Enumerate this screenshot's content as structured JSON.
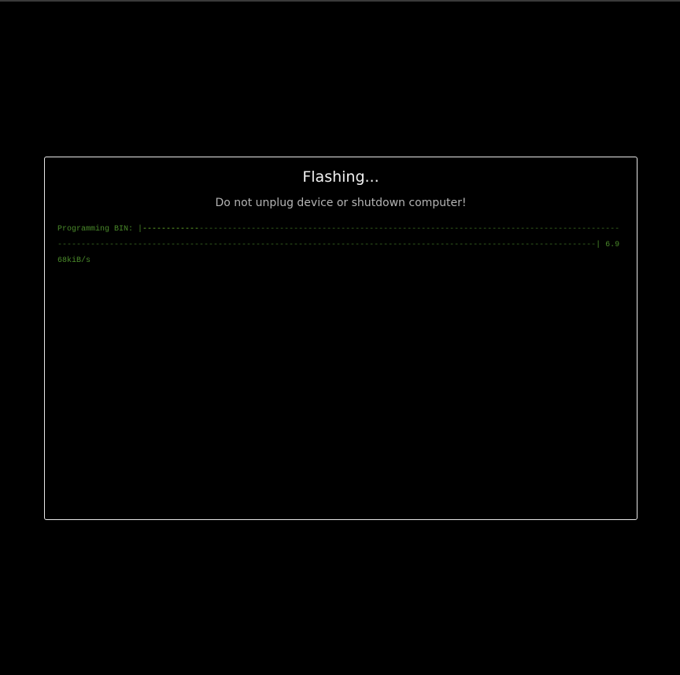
{
  "dialog": {
    "title": "Flashing...",
    "subtitle": "Do not unplug device or shutdown computer!"
  },
  "console": {
    "label": "Programming BIN: ",
    "bar_open": "|",
    "bar_filled": "------------",
    "bar_empty": "-----------------------------------------------------------------------------------------------------------------------------------------------------------------------------------------------------------",
    "bar_close": "|",
    "rate": " 6.968kiB/s"
  },
  "colors": {
    "background": "#000000",
    "dialog_border": "#e8e8e8",
    "console_text": "#4a8a2a",
    "progress_filled": "#6fbf2f",
    "progress_empty": "#3c6e22"
  }
}
